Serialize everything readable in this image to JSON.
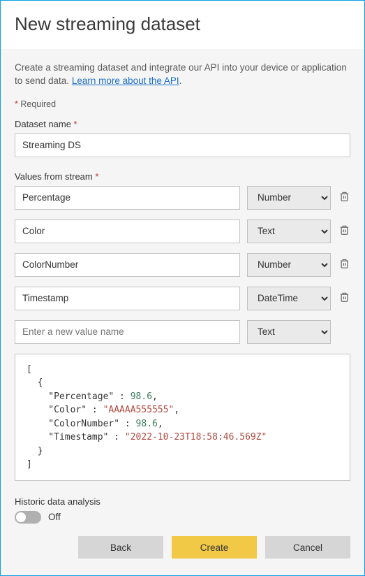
{
  "header": {
    "title": "New streaming dataset"
  },
  "desc": {
    "text_before_link": "Create a streaming dataset and integrate our API into your device or application to send data. ",
    "link_text": "Learn more about the API",
    "text_after_link": "."
  },
  "required_note": {
    "prefix": "* ",
    "label": "Required"
  },
  "dataset_name": {
    "label": "Dataset name ",
    "required_mark": "*",
    "value": "Streaming DS"
  },
  "values_from_stream": {
    "label": "Values from stream ",
    "required_mark": "*"
  },
  "type_options": [
    "Number",
    "Text",
    "DateTime"
  ],
  "rows": [
    {
      "name": "Percentage",
      "type": "Number"
    },
    {
      "name": "Color",
      "type": "Text"
    },
    {
      "name": "ColorNumber",
      "type": "Number"
    },
    {
      "name": "Timestamp",
      "type": "DateTime"
    }
  ],
  "new_row": {
    "placeholder": "Enter a new value name",
    "type": "Text"
  },
  "code": {
    "lines": [
      {
        "t": "["
      },
      {
        "t": "  {"
      },
      {
        "k": "Percentage",
        "v": "98.6",
        "vt": "num",
        "comma": true
      },
      {
        "k": "Color",
        "v": "\"AAAAA555555\"",
        "vt": "str",
        "comma": true
      },
      {
        "k": "ColorNumber",
        "v": "98.6",
        "vt": "num",
        "comma": true
      },
      {
        "k": "Timestamp",
        "v": "\"2022-10-23T18:58:46.569Z\"",
        "vt": "str",
        "comma": false
      },
      {
        "t": "  }"
      },
      {
        "t": "]"
      }
    ]
  },
  "historic": {
    "label": "Historic data analysis",
    "state_text": "Off",
    "on": false
  },
  "buttons": {
    "back": "Back",
    "create": "Create",
    "cancel": "Cancel"
  }
}
